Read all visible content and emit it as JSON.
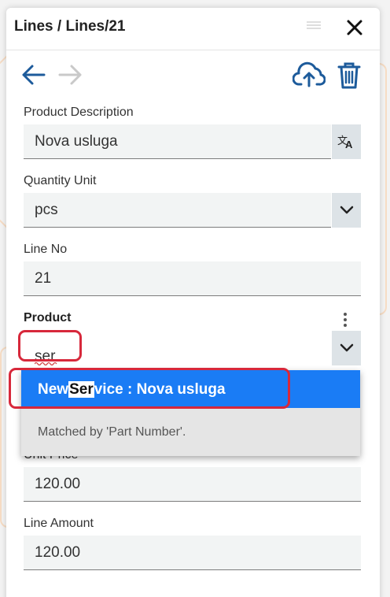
{
  "window": {
    "title": "Lines / Lines/21",
    "menu_icon": "hamburger-icon",
    "close_icon": "close-icon"
  },
  "toolbar": {
    "back_icon": "arrow-left-icon",
    "forward_icon": "arrow-right-icon",
    "upload_icon": "cloud-upload-icon",
    "delete_icon": "trash-icon"
  },
  "form": {
    "product_description": {
      "label": "Product Description",
      "value": "Nova usluga",
      "button_icon": "translate-icon"
    },
    "quantity_unit": {
      "label": "Quantity Unit",
      "value": "pcs",
      "button_icon": "chevron-down-icon"
    },
    "line_no": {
      "label": "Line No",
      "value": "21"
    },
    "product": {
      "label": "Product",
      "value": "ser",
      "button_icon": "chevron-down-icon",
      "menu_icon": "kebab-icon"
    },
    "unit_price": {
      "label": "Unit Price",
      "value": "120.00"
    },
    "line_amount": {
      "label": "Line Amount",
      "value": "120.00"
    }
  },
  "autocomplete": {
    "option": {
      "prefix": "New",
      "match": "Ser",
      "suffix": "vice : Nova usluga"
    },
    "hint": "Matched by 'Part Number'."
  },
  "colors": {
    "accent": "#2b579a",
    "selected_option": "#1a7cf5",
    "highlight_annotation": "#d7283b"
  }
}
